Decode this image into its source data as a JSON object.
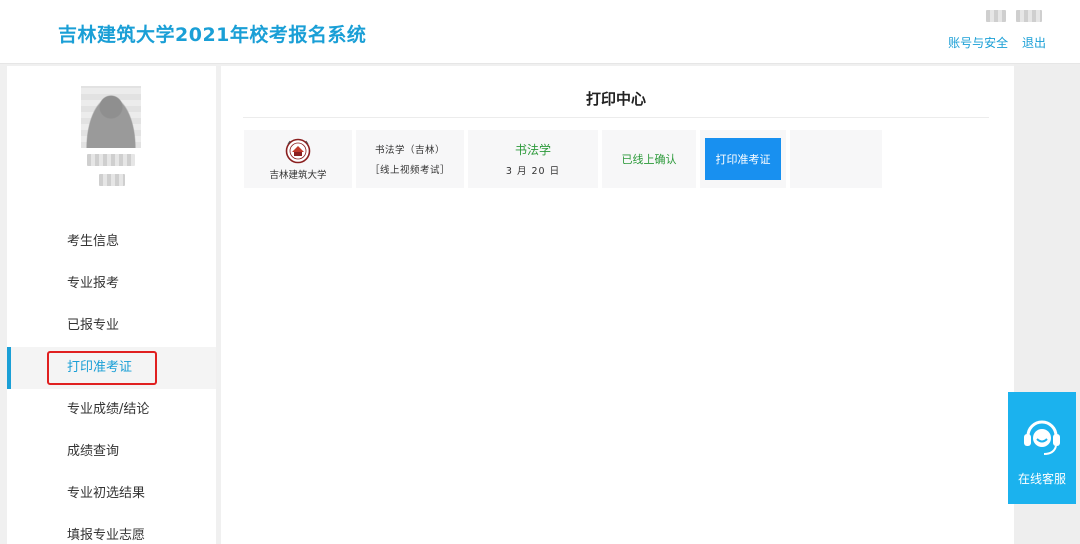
{
  "header": {
    "title": "吉林建筑大学2021年校考报名系统",
    "links": {
      "account": "账号与安全",
      "logout": "退出"
    }
  },
  "sidebar": {
    "menu": [
      {
        "label": "考生信息"
      },
      {
        "label": "专业报考"
      },
      {
        "label": "已报专业"
      },
      {
        "label": "打印准考证",
        "active": true
      },
      {
        "label": "专业成绩/结论"
      },
      {
        "label": "成绩查询"
      },
      {
        "label": "专业初选结果"
      },
      {
        "label": "填报专业志愿"
      }
    ]
  },
  "main": {
    "title": "打印中心",
    "record": {
      "school": "吉林建筑大学",
      "subject_line1": "书法学（吉林）",
      "subject_line2": "［线上视频考试］",
      "major": "书法学",
      "date": "3 月 20 日",
      "status": "已线上确认",
      "action": "打印准考证"
    }
  },
  "service": {
    "label": "在线客服"
  },
  "colors": {
    "accent": "#1a9fd6",
    "button": "#1890f0",
    "success": "#2c9a3a",
    "highlight": "#e02020",
    "service": "#1bb2ee"
  },
  "icons": {
    "school_logo": "university-emblem-icon",
    "service": "headset-icon"
  }
}
